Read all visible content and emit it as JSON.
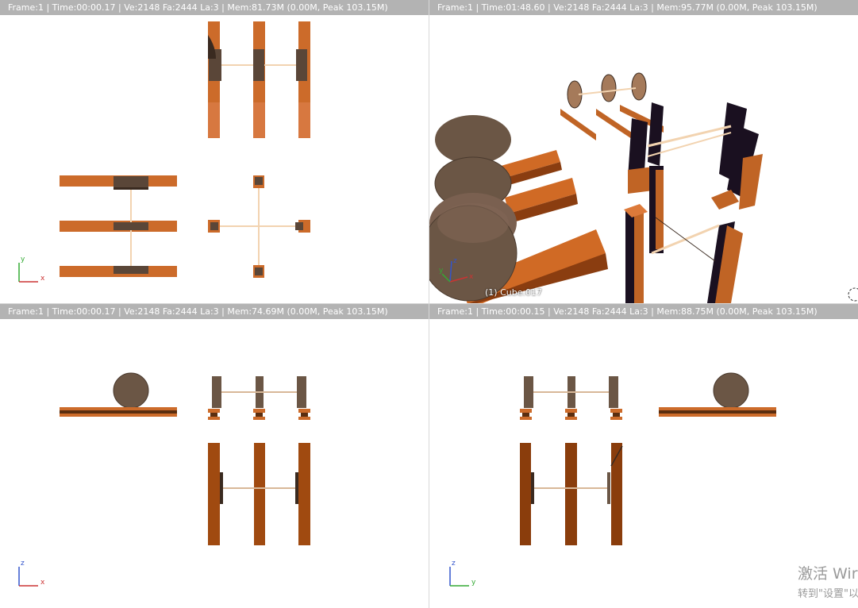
{
  "viewports": {
    "top_left": {
      "header": "Frame:1 | Time:00:00.17 | Ve:2148 Fa:2444 La:3 | Mem:81.73M (0.00M, Peak 103.15M)",
      "axes": [
        "y",
        "x"
      ]
    },
    "top_right": {
      "header": "Frame:1 | Time:01:48.60 | Ve:2148 Fa:2444 La:3 | Mem:95.77M (0.00M, Peak 103.15M)",
      "object_label": "(1) Cube.017",
      "axes": [
        "z",
        "y",
        "x"
      ]
    },
    "bottom_left": {
      "header": "Frame:1 | Time:00:00.17 | Ve:2148 Fa:2444 La:3 | Mem:74.69M (0.00M, Peak 103.15M)",
      "axes": [
        "z",
        "x"
      ]
    },
    "bottom_right": {
      "header": "Frame:1 | Time:00:00.15 | Ve:2148 Fa:2444 La:3 | Mem:88.75M (0.00M, Peak 103.15M)",
      "axes": [
        "z",
        "y"
      ]
    }
  },
  "watermark": {
    "line1": "激活 Wir",
    "line2": "转到\"设置\"以"
  },
  "colors": {
    "header_bg": "#b3b3b3",
    "rail": "#cc6b2a",
    "wheel": "#6b5645",
    "axis_x": "#cc3333",
    "axis_y": "#33aa33",
    "axis_z": "#3355cc"
  }
}
